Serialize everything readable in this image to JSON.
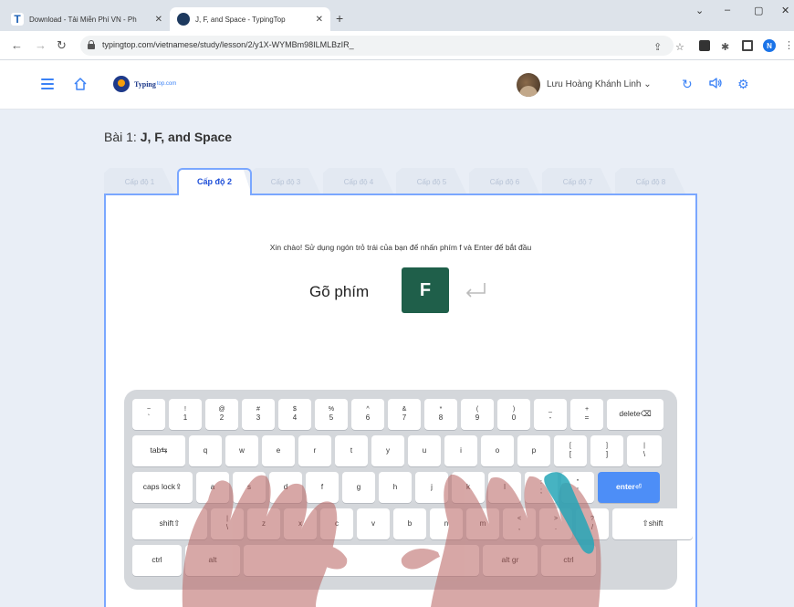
{
  "browser": {
    "tabs": [
      {
        "title": "Download - Tải Miễn Phí VN - Ph",
        "active": false
      },
      {
        "title": "J, F, and Space - TypingTop",
        "active": true
      }
    ],
    "new_tab": "+",
    "window_controls": [
      "⌄",
      "–",
      "▢",
      "✕"
    ],
    "url": "typingtop.com/vietnamese/study/lesson/2/y1X-WYMBm98ILMLBzIR_",
    "profile_initial": "N"
  },
  "site": {
    "logo_text": "Typing",
    "logo_domain": "top.com",
    "username": "Lưu Hoàng Khánh Linh",
    "username_caret": "⌄"
  },
  "lesson": {
    "title_prefix": "Bài 1:",
    "title_name": "J, F, and Space",
    "levels": [
      "Cấp độ 1",
      "Cấp độ 2",
      "Cấp độ 3",
      "Cấp độ 4",
      "Cấp độ 5",
      "Cấp độ 6",
      "Cấp độ 7",
      "Cấp độ 8"
    ],
    "active_level": 2,
    "instruction": "Xin chào! Sử dụng ngón trỏ trái của bạn để nhấn phím f và Enter để bắt đầu",
    "prompt_label": "Gõ phím",
    "prompt_key": "F"
  },
  "keyboard": {
    "row1": [
      [
        "~",
        "`"
      ],
      [
        "!",
        "1"
      ],
      [
        "@",
        "2"
      ],
      [
        "#",
        "3"
      ],
      [
        "$",
        "4"
      ],
      [
        "%",
        "5"
      ],
      [
        "^",
        "6"
      ],
      [
        "&",
        "7"
      ],
      [
        "*",
        "8"
      ],
      [
        "(",
        "9"
      ],
      [
        ")",
        "0"
      ],
      [
        "_",
        "-"
      ],
      [
        "+",
        "="
      ],
      [
        "delete⌫",
        ""
      ]
    ],
    "row2": [
      [
        "tab⇆",
        ""
      ],
      [
        "",
        "q"
      ],
      [
        "",
        "w"
      ],
      [
        "",
        "e"
      ],
      [
        "",
        "r"
      ],
      [
        "",
        "t"
      ],
      [
        "",
        "y"
      ],
      [
        "",
        "u"
      ],
      [
        "",
        "i"
      ],
      [
        "",
        "o"
      ],
      [
        "",
        "p"
      ],
      [
        "[",
        "["
      ],
      [
        "]",
        "]"
      ],
      [
        "|",
        "\\"
      ]
    ],
    "row3": [
      [
        "caps lock⇪",
        ""
      ],
      [
        "",
        "a"
      ],
      [
        "",
        "s"
      ],
      [
        "",
        "d"
      ],
      [
        "",
        "f"
      ],
      [
        "",
        "g"
      ],
      [
        "",
        "h"
      ],
      [
        "",
        "j"
      ],
      [
        "",
        "k"
      ],
      [
        "",
        "l"
      ],
      [
        ":",
        ";"
      ],
      [
        "\"",
        "'"
      ],
      [
        "enter⏎",
        ""
      ]
    ],
    "row4": [
      [
        "shift⇧",
        ""
      ],
      [
        "|",
        "\\"
      ],
      [
        "",
        "z"
      ],
      [
        "",
        "x"
      ],
      [
        "",
        "c"
      ],
      [
        "",
        "v"
      ],
      [
        "",
        "b"
      ],
      [
        "",
        "n"
      ],
      [
        "",
        "m"
      ],
      [
        "<",
        ","
      ],
      [
        ">",
        "."
      ],
      [
        "?",
        "/"
      ],
      [
        "⇧shift",
        ""
      ]
    ],
    "row5": [
      [
        "ctrl",
        ""
      ],
      [
        "alt",
        ""
      ],
      [
        "",
        ""
      ],
      [
        "alt gr",
        ""
      ],
      [
        "ctrl",
        ""
      ]
    ]
  },
  "colors": {
    "accent": "#3b82f6",
    "key_highlight": "#1f5f4a",
    "enter_key": "#4d8ef7",
    "panel_border": "#7aa7ff"
  }
}
